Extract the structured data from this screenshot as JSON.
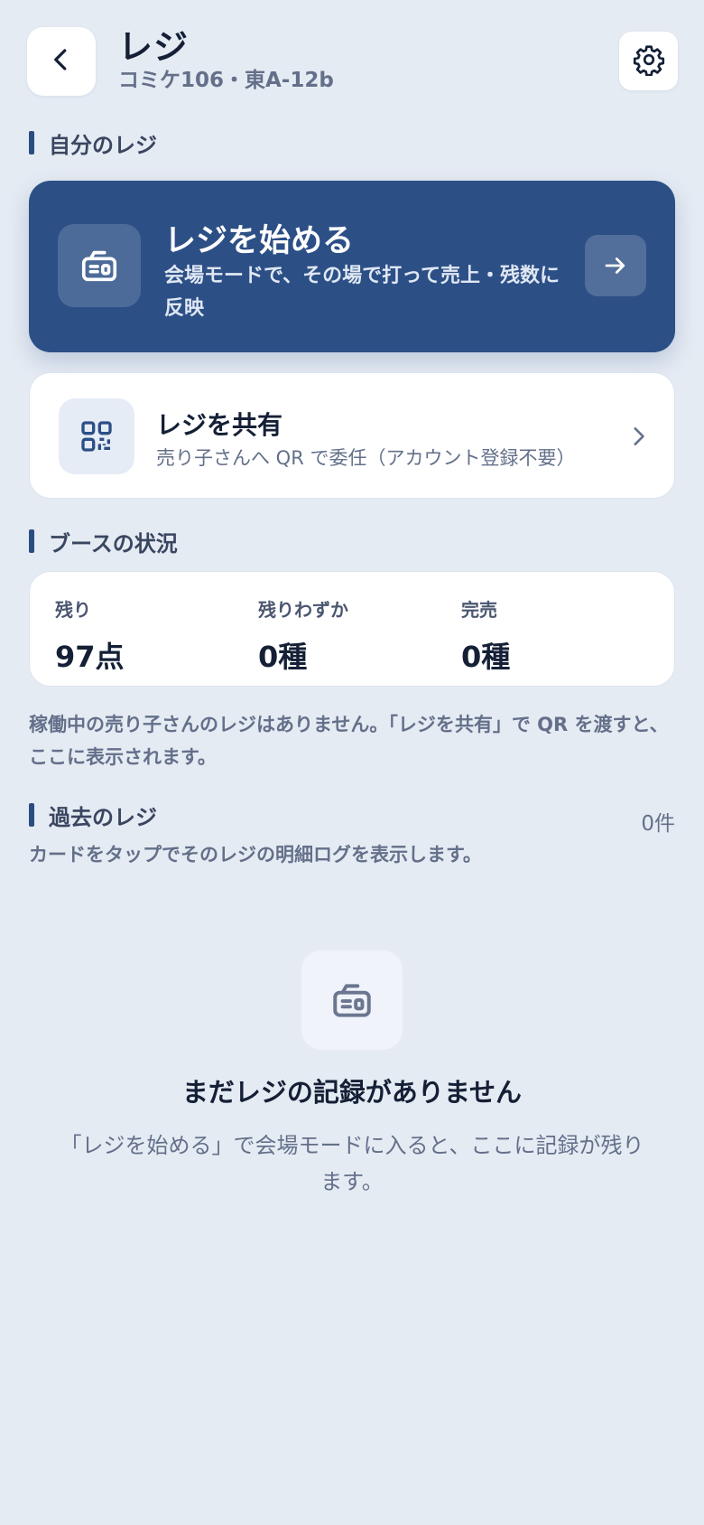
{
  "header": {
    "title": "レジ",
    "subtitle": "コミケ106・東A-12b",
    "back_icon": "chevron-left-icon",
    "settings_icon": "gear-icon"
  },
  "my_register": {
    "section_title": "自分のレジ",
    "start_card": {
      "title": "レジを始める",
      "description": "会場モードで、その場で打って売上・残数に反映",
      "icon": "register-icon",
      "arrow_icon": "arrow-right-icon"
    },
    "share_card": {
      "title": "レジを共有",
      "description": "売り子さんへ QR で委任（アカウント登録不要）",
      "icon": "qr-code-icon",
      "chevron_icon": "chevron-right-icon"
    }
  },
  "booth_status": {
    "section_title": "ブースの状況",
    "stats": [
      {
        "label": "残り",
        "value": "97点"
      },
      {
        "label": "残りわずか",
        "value": "0種"
      },
      {
        "label": "完売",
        "value": "0種"
      }
    ],
    "note": "稼働中の売り子さんのレジはありません。「レジを共有」で QR を渡すと、ここに表示されます。"
  },
  "history": {
    "section_title": "過去のレジ",
    "count": "0件",
    "description": "カードをタップでそのレジの明細ログを表示します。",
    "empty": {
      "icon": "register-icon",
      "title": "まだレジの記録がありません",
      "description": "「レジを始める」で会場モードに入ると、ここに記録が残ります。"
    }
  },
  "colors": {
    "background": "#e5ebf3",
    "primary": "#2c4f86",
    "card": "#ffffff",
    "text": "#152036",
    "muted": "#64708a"
  }
}
